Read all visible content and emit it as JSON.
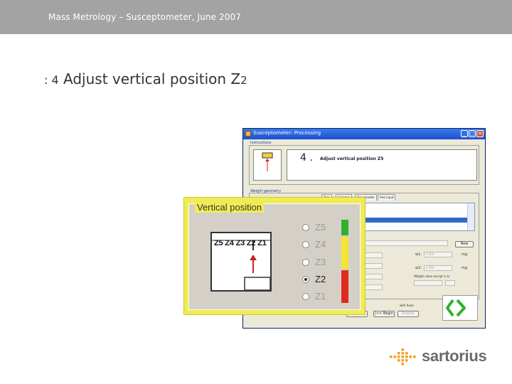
{
  "header": {
    "text": "Mass Metrology – Susceptometer, June 2007"
  },
  "slide": {
    "title_prefix": ": 4",
    "title_main": "Adjust vertical position Z",
    "title_sub": "2"
  },
  "window": {
    "title": "Susceptometer: Processing",
    "buttons": {
      "minimize": "_",
      "maximize": "□",
      "close": "✕"
    },
    "instructions": {
      "group_label": "Instructions",
      "step_number": "4 .",
      "step_text": "Adjust vertical position Z5"
    },
    "weight_geometry": {
      "group_label": "Weight geometry",
      "tabs": [
        "Disk",
        "Cylinder",
        "Tier cylinder",
        "free input"
      ]
    },
    "fields": {
      "w1_label": "w1:",
      "w1_value": "0.000",
      "w1_unit": "mg",
      "w2_label": "w2:",
      "w2_value": "0.000",
      "w2_unit": "mg",
      "new_button": "New",
      "weight_value_label": "Weight value except in k/"
    },
    "checkbox_label": "with Ruler",
    "bottom_buttons": {
      "begin": "|<< Begin",
      "back": "",
      "repeat": "Repeat"
    }
  },
  "vertical_position": {
    "legend": "Vertical position",
    "z_labels": "Z5 Z4 Z3 Z2 Z1",
    "options": [
      {
        "label": "Z5",
        "checked": false,
        "color": "#2fb12f"
      },
      {
        "label": "Z4",
        "checked": false,
        "color": "#f3e530"
      },
      {
        "label": "Z3",
        "checked": false,
        "color": "#f3e530"
      },
      {
        "label": "Z2",
        "checked": true,
        "color": "#e02a1e"
      },
      {
        "label": "Z1",
        "checked": false,
        "color": "#e02a1e"
      }
    ],
    "arrow_color": "#cc2222"
  },
  "logo": {
    "text": "sartorius",
    "dot_color": "#f0a020"
  }
}
